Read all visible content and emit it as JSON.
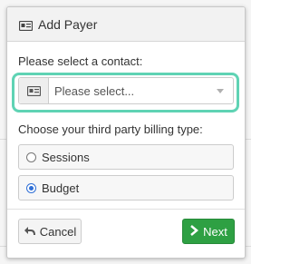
{
  "dialog": {
    "title": "Add Payer",
    "title_icon": "id-card-icon"
  },
  "contact": {
    "label": "Please select a contact:",
    "addon_icon": "id-card-icon",
    "select_value": "Please select..."
  },
  "billing": {
    "label": "Choose your third party billing type:",
    "options": [
      {
        "label": "Sessions",
        "selected": false
      },
      {
        "label": "Budget",
        "selected": true
      }
    ]
  },
  "footer": {
    "cancel_label": "Cancel",
    "cancel_icon": "undo-arrow-icon",
    "next_label": "Next",
    "next_icon": "chevron-right-icon"
  },
  "colors": {
    "highlight_ring": "#5fd3b4",
    "next_button": "#2ea043",
    "radio_checked": "#2f6fd6"
  }
}
